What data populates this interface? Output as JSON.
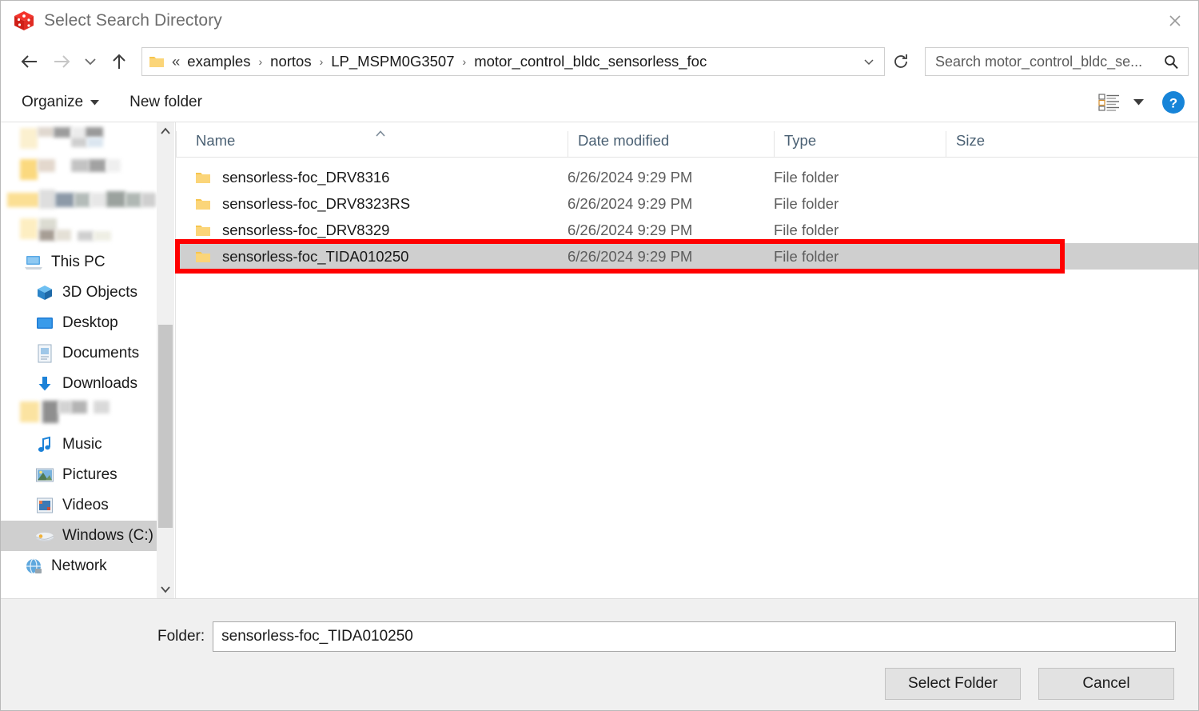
{
  "window": {
    "title": "Select Search Directory",
    "app_icon": "red-cube-icon",
    "close_label": "✕"
  },
  "navbar": {
    "back_icon": "arrow-left-icon",
    "forward_icon": "arrow-right-icon",
    "recent_icon": "chevron-down-icon",
    "up_icon": "arrow-up-icon",
    "refresh_icon": "refresh-icon",
    "address_folder_icon": "folder-icon",
    "breadcrumb_prefix": "«",
    "breadcrumbs": [
      "examples",
      "nortos",
      "LP_MSPM0G3507",
      "motor_control_bldc_sensorless_foc"
    ],
    "separator": "›",
    "address_caret": "chevron-down-icon"
  },
  "search": {
    "placeholder": "Search motor_control_bldc_se...",
    "value": "",
    "icon": "search-icon"
  },
  "toolbar": {
    "organize_label": "Organize",
    "organize_caret": "caret-down-icon",
    "new_folder_label": "New folder",
    "view_icon": "list-view-icon",
    "view_caret": "caret-down-icon",
    "help_label": "?"
  },
  "sidebar": {
    "scrollbar": {
      "up_icon": "chevron-up-icon",
      "down_icon": "chevron-down-icon"
    },
    "items": [
      {
        "label": "",
        "icon": "redacted",
        "redacted": true,
        "selected": false
      },
      {
        "label": "",
        "icon": "redacted",
        "redacted": true,
        "selected": false
      },
      {
        "label": "",
        "icon": "redacted",
        "redacted": true,
        "selected": false
      },
      {
        "label": "",
        "icon": "redacted",
        "redacted": true,
        "selected": false
      },
      {
        "label": "This PC",
        "icon": "this-pc-icon",
        "redacted": false,
        "selected": false
      },
      {
        "label": "3D Objects",
        "icon": "3d-objects-icon",
        "redacted": false,
        "selected": false
      },
      {
        "label": "Desktop",
        "icon": "desktop-icon",
        "redacted": false,
        "selected": false
      },
      {
        "label": "Documents",
        "icon": "documents-icon",
        "redacted": false,
        "selected": false
      },
      {
        "label": "Downloads",
        "icon": "downloads-icon",
        "redacted": false,
        "selected": false
      },
      {
        "label": "",
        "icon": "redacted",
        "redacted": true,
        "selected": false
      },
      {
        "label": "Music",
        "icon": "music-icon",
        "redacted": false,
        "selected": false
      },
      {
        "label": "Pictures",
        "icon": "pictures-icon",
        "redacted": false,
        "selected": false
      },
      {
        "label": "Videos",
        "icon": "videos-icon",
        "redacted": false,
        "selected": false
      },
      {
        "label": "Windows (C:)",
        "icon": "drive-icon",
        "redacted": false,
        "selected": true
      },
      {
        "label": "Network",
        "icon": "network-icon",
        "redacted": false,
        "selected": false
      }
    ]
  },
  "filelist": {
    "columns": [
      {
        "label": "Name",
        "sorted": "asc"
      },
      {
        "label": "Date modified",
        "sorted": ""
      },
      {
        "label": "Type",
        "sorted": ""
      },
      {
        "label": "Size",
        "sorted": ""
      }
    ],
    "sort_caret": "caret-up-icon",
    "rows": [
      {
        "name": "sensorless-foc_DRV8316",
        "date": "6/26/2024 9:29 PM",
        "type": "File folder",
        "size": "",
        "icon": "folder-icon",
        "selected": false,
        "annotated": false
      },
      {
        "name": "sensorless-foc_DRV8323RS",
        "date": "6/26/2024 9:29 PM",
        "type": "File folder",
        "size": "",
        "icon": "folder-icon",
        "selected": false,
        "annotated": false
      },
      {
        "name": "sensorless-foc_DRV8329",
        "date": "6/26/2024 9:29 PM",
        "type": "File folder",
        "size": "",
        "icon": "folder-icon",
        "selected": false,
        "annotated": false
      },
      {
        "name": "sensorless-foc_TIDA010250",
        "date": "6/26/2024 9:29 PM",
        "type": "File folder",
        "size": "",
        "icon": "folder-icon",
        "selected": true,
        "annotated": true
      }
    ]
  },
  "footer": {
    "folder_label": "Folder:",
    "folder_value": "sensorless-foc_TIDA010250",
    "select_button": "Select Folder",
    "cancel_button": "Cancel"
  },
  "colors": {
    "annotation": "#ff0000",
    "selection": "#cfcfcf",
    "folder_yellow": "#fcd77a",
    "accent_blue": "#0a7bd4",
    "header_text": "#4a6073"
  }
}
